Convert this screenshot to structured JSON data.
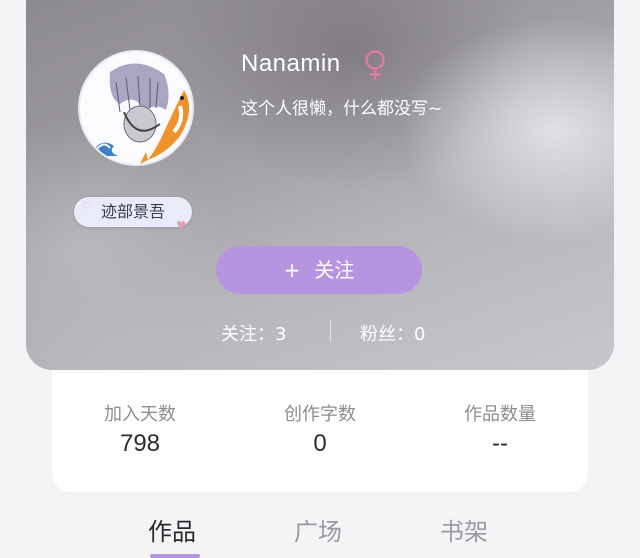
{
  "profile": {
    "username": "Nanamin",
    "gender_icon": "female-symbol-icon",
    "bio": "这个人很懒，什么都没写~",
    "tag": "迹部景吾",
    "follow_button": "关注",
    "follow_icon": "+",
    "following_label": "关注：3",
    "followers_label": "粉丝：0"
  },
  "stats": [
    {
      "label": "加入天数",
      "value": "798"
    },
    {
      "label": "创作字数",
      "value": "0"
    },
    {
      "label": "作品数量",
      "value": "--"
    }
  ],
  "tabs": [
    {
      "label": "作品",
      "active": true
    },
    {
      "label": "广场",
      "active": false
    },
    {
      "label": "书架",
      "active": false
    }
  ],
  "colors": {
    "accent": "#b794e0",
    "gender": "#e07a9a",
    "tag_bg": "#e9ecf8"
  }
}
